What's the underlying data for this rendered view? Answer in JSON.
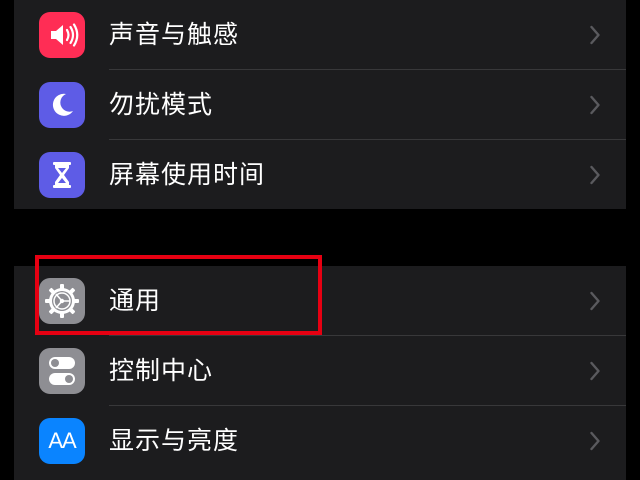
{
  "settings_list": {
    "group_1": [
      {
        "label": "声音与触感",
        "icon": "speaker-icon",
        "icon_color": "#ff2d55"
      },
      {
        "label": "勿扰模式",
        "icon": "moon-icon",
        "icon_color": "#5e5ce6"
      },
      {
        "label": "屏幕使用时间",
        "icon": "hourglass-icon",
        "icon_color": "#5e5ce6"
      }
    ],
    "group_2": [
      {
        "label": "通用",
        "icon": "gear-icon",
        "icon_color": "#8e8e93"
      },
      {
        "label": "控制中心",
        "icon": "toggles-icon",
        "icon_color": "#8e8e93"
      },
      {
        "label": "显示与亮度",
        "icon": "text-size-icon",
        "icon_color": "#0a84ff",
        "icon_text": "AA"
      }
    ]
  },
  "highlight": {
    "target": "通用",
    "color": "#e60012"
  },
  "colors": {
    "background": "#000000",
    "cell": "#1c1c1e",
    "separator": "#38383a",
    "chevron": "#5a5a5e",
    "text": "#ffffff"
  }
}
